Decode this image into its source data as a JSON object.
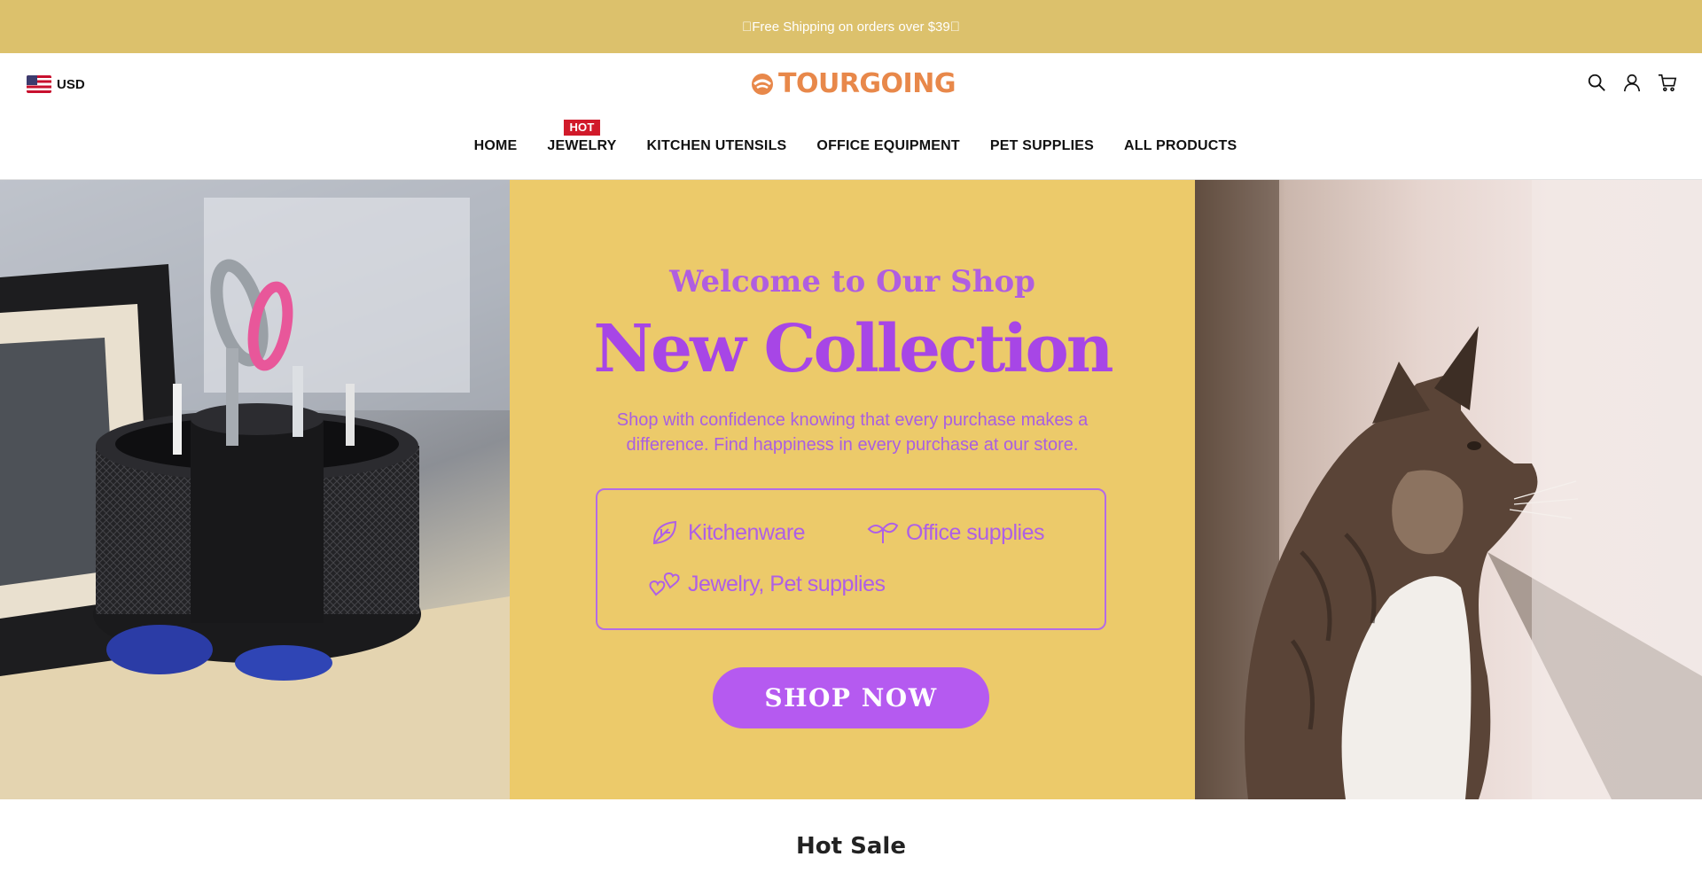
{
  "announcement": {
    "text": "\u0000Free Shipping on orders over $39\u0000"
  },
  "header": {
    "currency": "USD",
    "logo_text": "TOURGOING",
    "nav": [
      {
        "label": "HOME"
      },
      {
        "label": "JEWELRY",
        "badge": "HOT"
      },
      {
        "label": "KITCHEN UTENSILS"
      },
      {
        "label": "OFFICE EQUIPMENT"
      },
      {
        "label": "PET SUPPLIES"
      },
      {
        "label": "ALL PRODUCTS"
      }
    ],
    "icons": [
      "search-icon",
      "account-icon",
      "cart-icon"
    ]
  },
  "hero": {
    "welcome": "Welcome to Our Shop",
    "title": "New Collection",
    "subtitle": "Shop with confidence knowing that every purchase makes a difference. Find happiness in every purchase at our store.",
    "categories": [
      {
        "label": "Kitchenware",
        "icon": "leaf-icon"
      },
      {
        "label": "Office supplies",
        "icon": "leaves-icon"
      },
      {
        "label": "Jewelry, Pet supplies",
        "icon": "hearts-icon"
      }
    ],
    "button": "SHOP NOW",
    "left_image": "desk-organizer-photo",
    "right_image": "cat-photo"
  },
  "section_title": "Hot Sale",
  "colors": {
    "announcement_bg": "#dcc16c",
    "brand": "#e8884a",
    "hero_bg": "#ecca6a",
    "accent_purple": "#a746e6",
    "hot_badge": "#d11a2a"
  }
}
